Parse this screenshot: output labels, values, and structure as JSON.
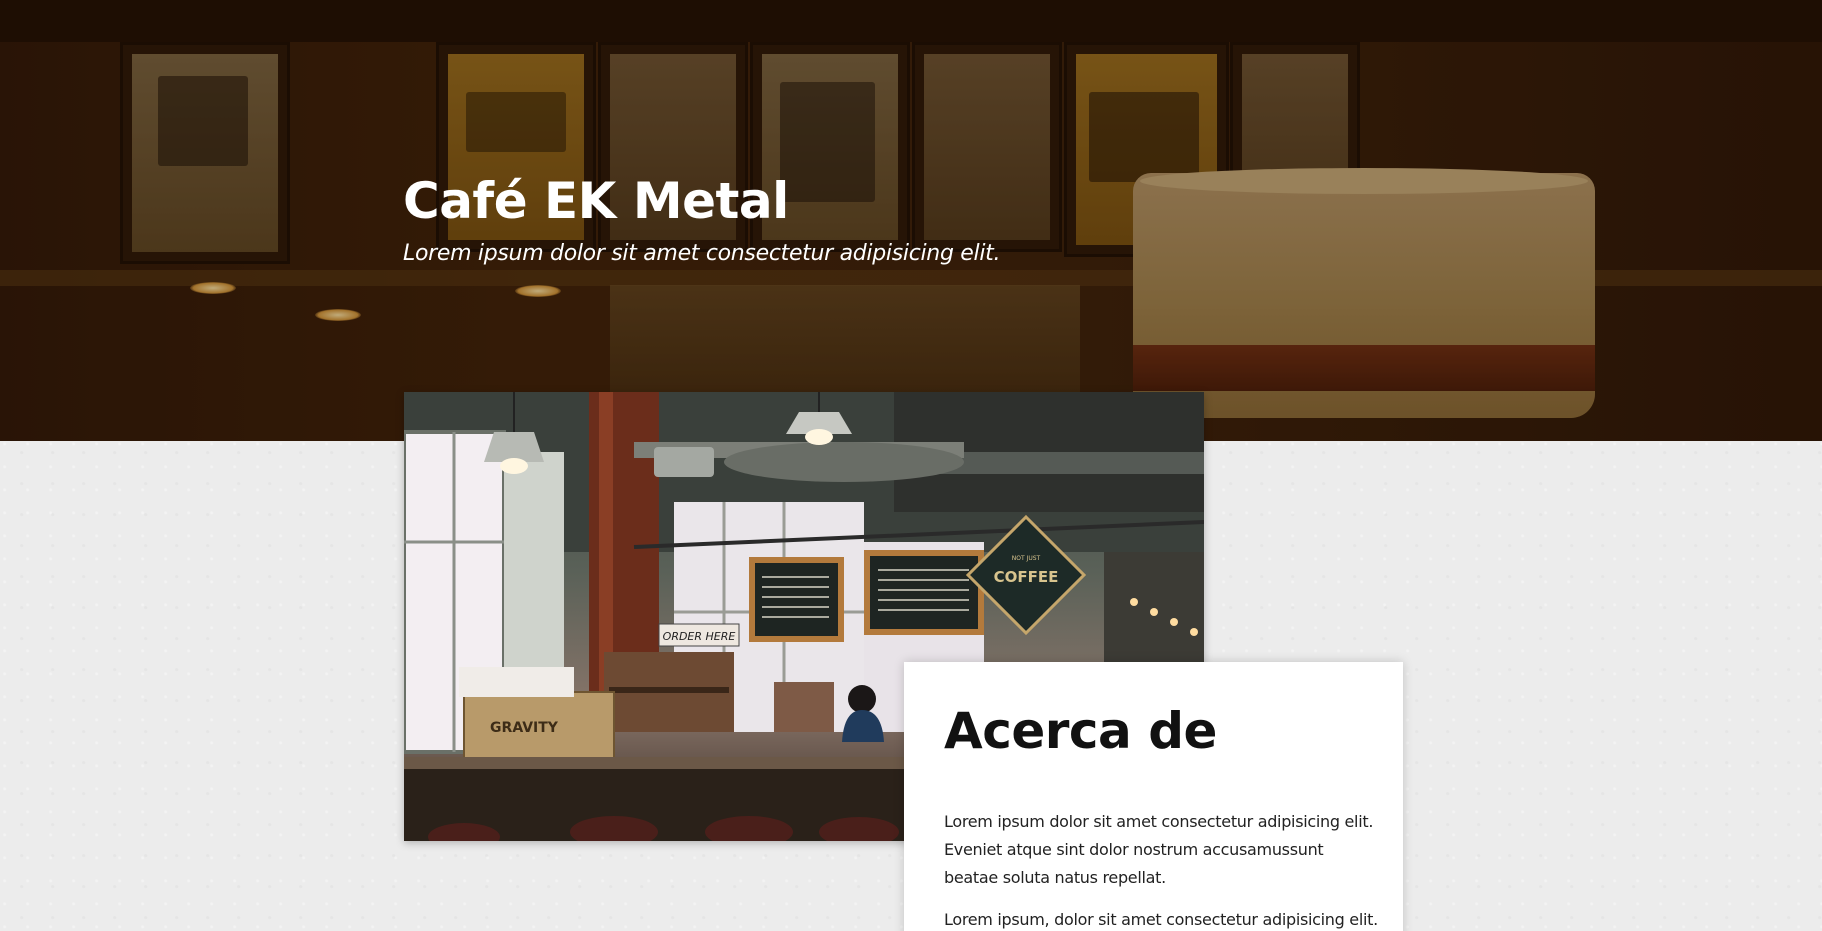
{
  "hero": {
    "title": "Café EK Metal",
    "subtitle": "Lorem ipsum dolor sit amet consectetur adipisicing elit."
  },
  "photo": {
    "sign_order": "ORDER HERE",
    "sign_coffee": "COFFEE",
    "sign_coffee_top": "NOT JUST",
    "crate_text": "GRAVITY"
  },
  "about": {
    "heading": "Acerca de",
    "paragraphs": [
      "Lorem ipsum dolor sit amet consectetur adipisicing elit. Eveniet atque sint dolor nostrum accusamussunt beatae soluta natus repellat.",
      "Lorem ipsum, dolor sit amet consectetur adipisicing elit."
    ]
  },
  "colors": {
    "hero_overlay": "#2f1707",
    "page_background": "#ececec",
    "card_background": "#ffffff",
    "text_dark": "#111111"
  }
}
